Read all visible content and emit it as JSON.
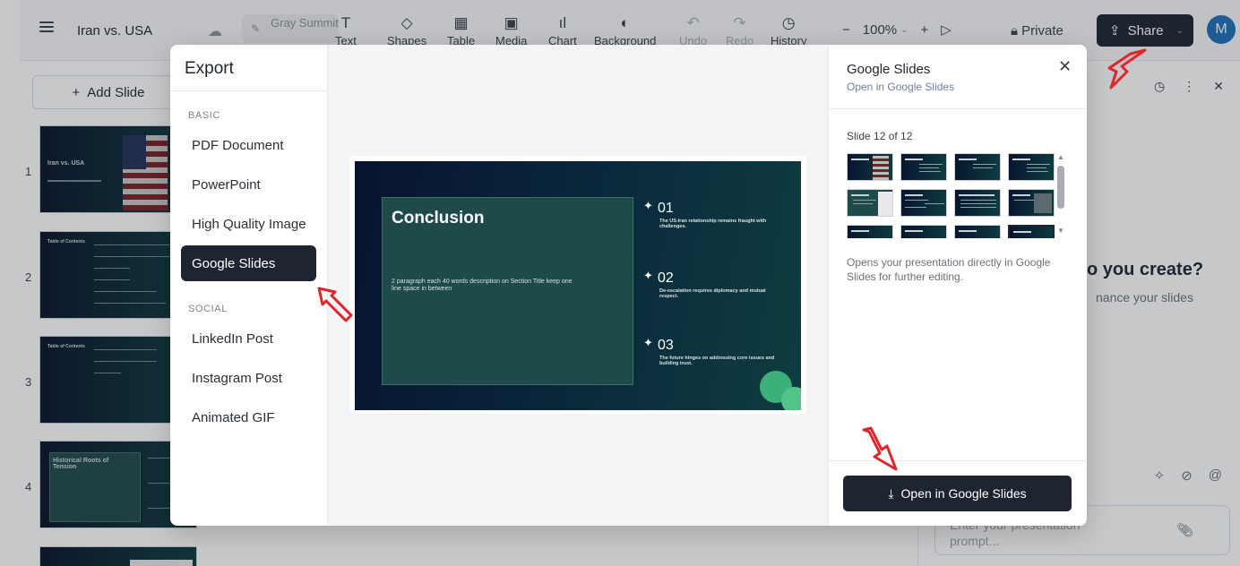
{
  "toolbar": {
    "title": "Iran vs. USA",
    "theme_name": "Gray Summit",
    "tools": [
      {
        "label": "Text",
        "icon": "T"
      },
      {
        "label": "Shapes",
        "icon": "◇"
      },
      {
        "label": "Table",
        "icon": "▦"
      },
      {
        "label": "Media",
        "icon": "▣"
      },
      {
        "label": "Chart",
        "icon": "ıl"
      },
      {
        "label": "Background",
        "icon": "◐"
      },
      {
        "label": "Undo",
        "icon": "↶"
      },
      {
        "label": "Redo",
        "icon": "↷"
      },
      {
        "label": "History",
        "icon": "◷"
      }
    ],
    "zoom_minus": "−",
    "zoom": "100%",
    "zoom_plus": "+",
    "play": "▷",
    "private": "Private",
    "share": "Share",
    "avatar": "M"
  },
  "sidebar": {
    "add_slide": "Add Slide",
    "numbers": [
      "1",
      "2",
      "3",
      "4"
    ],
    "thumb1_title": "Iran vs. USA",
    "thumb2_title": "Table of Contents",
    "thumb3_title": "Table of Contents",
    "thumb4_title": "Historical Roots of Tension"
  },
  "ai_panel": {
    "question": "o you create?",
    "sub": "nance your slides",
    "placeholder": "Enter your presentation prompt..."
  },
  "export": {
    "heading": "Export",
    "basic_label": "BASIC",
    "social_label": "SOCIAL",
    "basic_options": [
      "PDF Document",
      "PowerPoint",
      "High Quality Image",
      "Google Slides"
    ],
    "social_options": [
      "LinkedIn Post",
      "Instagram Post",
      "Animated GIF"
    ],
    "selected": "Google Slides"
  },
  "preview_slide": {
    "title": "Conclusion",
    "description": "2 paragraph each 40 words description on Section Title keep one line space in between",
    "items": [
      {
        "num": "01",
        "text": "The US-Iran relationship remains fraught with challenges."
      },
      {
        "num": "02",
        "text": "De-escalation requires diplomacy and mutual respect."
      },
      {
        "num": "03",
        "text": "The future hinges on addressing core issues and building trust."
      }
    ]
  },
  "google_slides": {
    "title": "Google Slides",
    "subtitle": "Open in Google Slides",
    "slide_count": "Slide 12 of 12",
    "description": "Opens your presentation directly in Google Slides for further editing.",
    "button": "Open in Google Slides"
  }
}
